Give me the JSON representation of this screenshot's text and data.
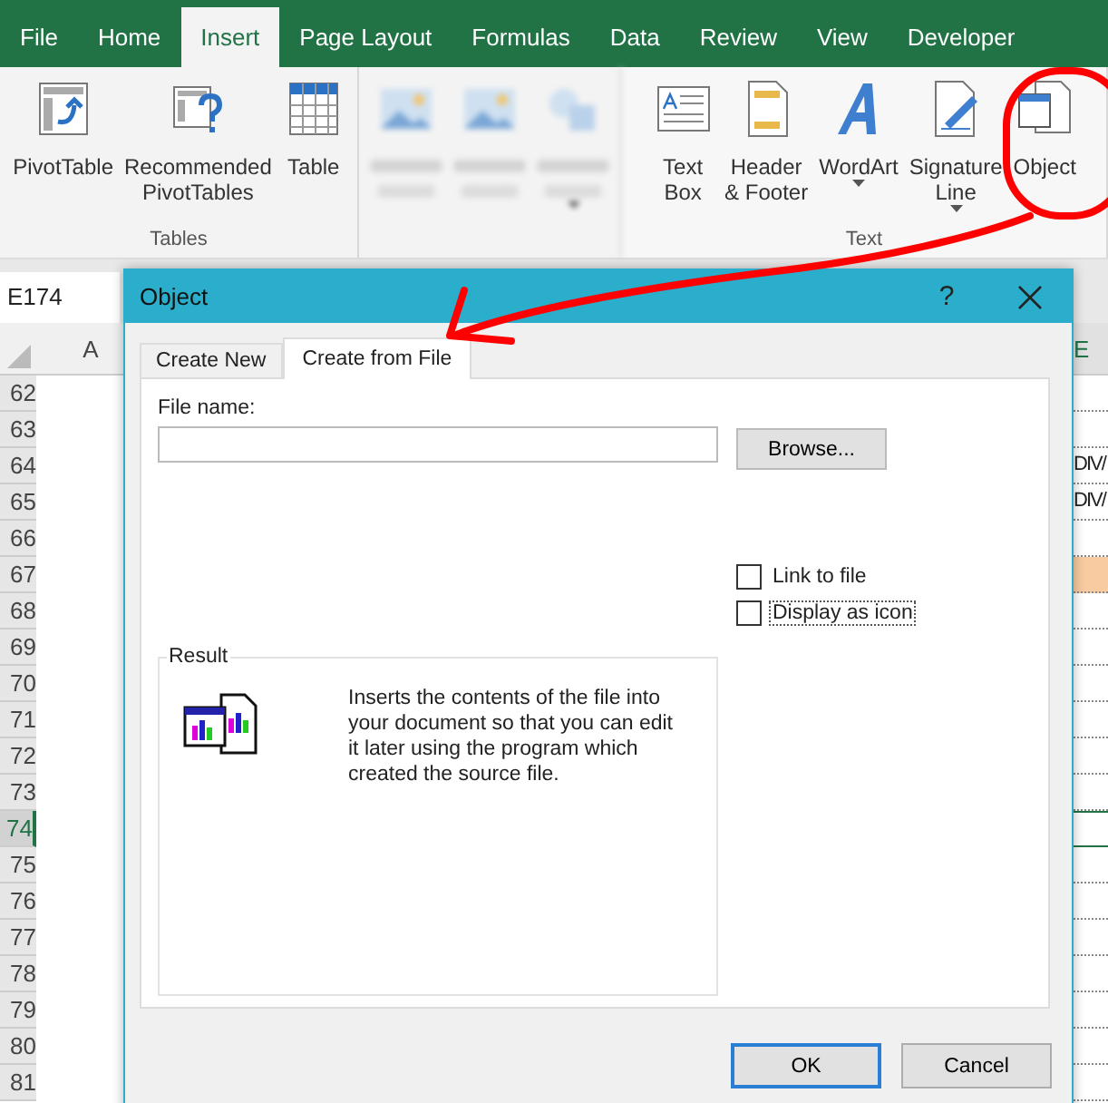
{
  "ribbon_tabs": [
    {
      "label": "File",
      "selected": false
    },
    {
      "label": "Home",
      "selected": false
    },
    {
      "label": "Insert",
      "selected": true
    },
    {
      "label": "Page Layout",
      "selected": false
    },
    {
      "label": "Formulas",
      "selected": false
    },
    {
      "label": "Data",
      "selected": false
    },
    {
      "label": "Review",
      "selected": false
    },
    {
      "label": "View",
      "selected": false
    },
    {
      "label": "Developer",
      "selected": false
    }
  ],
  "ribbon_groups": [
    {
      "label": "Tables",
      "blurred": false,
      "items": [
        {
          "kind": "pivot",
          "lines": [
            "PivotTable"
          ],
          "dropdown": false
        },
        {
          "kind": "recommended",
          "lines": [
            "Recommended",
            "PivotTables"
          ],
          "dropdown": false
        },
        {
          "kind": "table",
          "lines": [
            "Table"
          ],
          "dropdown": false
        }
      ]
    },
    {
      "blurred": true,
      "items": [
        {
          "kind": "picture",
          "dropdown": false
        },
        {
          "kind": "picture",
          "dropdown": false
        },
        {
          "kind": "shapes",
          "dropdown": true
        }
      ]
    },
    {
      "label": "Text",
      "blurred": false,
      "items": [
        {
          "kind": "textbox",
          "lines": [
            "Text",
            "Box"
          ],
          "dropdown": false
        },
        {
          "kind": "header",
          "lines": [
            "Header",
            "& Footer"
          ],
          "dropdown": false
        },
        {
          "kind": "wordart",
          "lines": [
            "WordArt"
          ],
          "dropdown": true
        },
        {
          "kind": "signature",
          "lines": [
            "Signature",
            "Line"
          ],
          "dropdown": true
        },
        {
          "kind": "object",
          "lines": [
            "Object"
          ],
          "dropdown": false
        }
      ]
    }
  ],
  "name_box": "E174",
  "column_headers": [
    "A",
    "E"
  ],
  "rows": [
    {
      "number": "62",
      "selected": false,
      "e_text": "",
      "highlighted": false
    },
    {
      "number": "63",
      "selected": false,
      "e_text": "",
      "highlighted": false
    },
    {
      "number": "64",
      "selected": false,
      "e_text": "DIV/",
      "highlighted": false
    },
    {
      "number": "65",
      "selected": false,
      "e_text": "DIV/",
      "highlighted": false
    },
    {
      "number": "66",
      "selected": false,
      "e_text": "",
      "highlighted": false
    },
    {
      "number": "67",
      "selected": false,
      "e_text": "",
      "highlighted": true
    },
    {
      "number": "68",
      "selected": false,
      "e_text": "",
      "highlighted": false
    },
    {
      "number": "69",
      "selected": false,
      "e_text": "",
      "highlighted": false
    },
    {
      "number": "70",
      "selected": false,
      "e_text": "",
      "highlighted": false
    },
    {
      "number": "71",
      "selected": false,
      "e_text": "",
      "highlighted": false
    },
    {
      "number": "72",
      "selected": false,
      "e_text": "",
      "highlighted": false
    },
    {
      "number": "73",
      "selected": false,
      "e_text": "",
      "highlighted": false
    },
    {
      "number": "74",
      "selected": true,
      "e_text": "",
      "highlighted": false
    },
    {
      "number": "75",
      "selected": false,
      "e_text": "",
      "highlighted": false
    },
    {
      "number": "76",
      "selected": false,
      "e_text": "",
      "highlighted": false
    },
    {
      "number": "77",
      "selected": false,
      "e_text": "",
      "highlighted": false
    },
    {
      "number": "78",
      "selected": false,
      "e_text": "",
      "highlighted": false
    },
    {
      "number": "79",
      "selected": false,
      "e_text": "",
      "highlighted": false
    },
    {
      "number": "80",
      "selected": false,
      "e_text": "",
      "highlighted": false
    },
    {
      "number": "81",
      "selected": false,
      "e_text": "",
      "highlighted": false
    }
  ],
  "dialog": {
    "title": "Object",
    "help": "?",
    "tabs": [
      {
        "label": "Create New",
        "selected": false
      },
      {
        "label": "Create from File",
        "selected": true
      }
    ],
    "file_name_label": "File name:",
    "browse_button": "Browse...",
    "checkboxes": [
      {
        "label": "Link to file",
        "checked": false,
        "focused": false
      },
      {
        "label": "Display as icon",
        "checked": false,
        "focused": true
      }
    ],
    "result": {
      "label": "Result",
      "description": "Inserts the contents of the file into your document so that you can edit it later using the program which created the source file."
    },
    "buttons": [
      {
        "label": "OK",
        "default": true
      },
      {
        "label": "Cancel",
        "default": false
      }
    ]
  }
}
